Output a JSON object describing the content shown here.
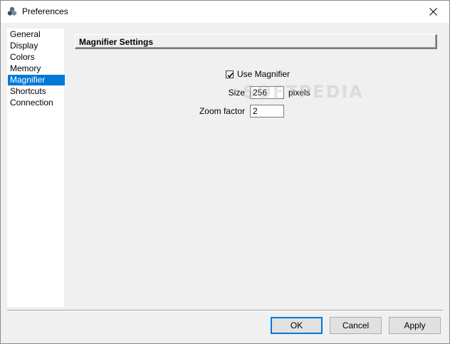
{
  "window": {
    "title": "Preferences"
  },
  "sidebar": {
    "items": [
      {
        "label": "General",
        "selected": false
      },
      {
        "label": "Display",
        "selected": false
      },
      {
        "label": "Colors",
        "selected": false
      },
      {
        "label": "Memory",
        "selected": false
      },
      {
        "label": "Magnifier",
        "selected": true
      },
      {
        "label": "Shortcuts",
        "selected": false
      },
      {
        "label": "Connection",
        "selected": false
      }
    ]
  },
  "magnifier": {
    "section_title": "Magnifier Settings",
    "use_magnifier_label": "Use Magnifier",
    "use_magnifier_checked": true,
    "size_label": "Size",
    "size_value": "256",
    "size_unit": "pixels",
    "zoom_label": "Zoom factor",
    "zoom_value": "2"
  },
  "watermark": "SOFTPEDIA",
  "buttons": {
    "ok": "OK",
    "cancel": "Cancel",
    "apply": "Apply"
  },
  "colors": {
    "selection": "#0078d7",
    "dialog_bg": "#f0f0f0"
  }
}
